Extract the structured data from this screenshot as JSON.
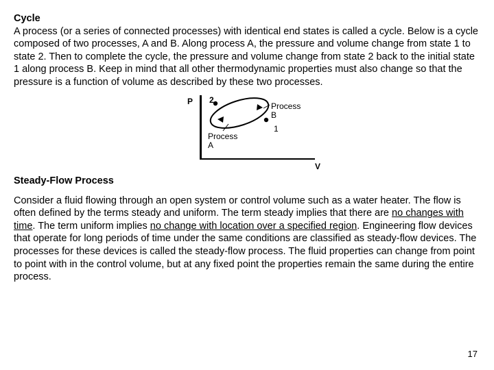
{
  "headings": {
    "cycle": "Cycle",
    "steady": "Steady-Flow Process"
  },
  "para_cycle": "A process (or a series of connected processes) with identical end states is called a cycle.  Below is a cycle composed of two processes, A and B.  Along process A, the pressure and volume change from state 1 to state 2. Then to complete the cycle, the pressure and volume change from state 2 back to the initial state 1 along process B.  Keep in mind that all other thermodynamic properties must also change so that the pressure is a function of volume as described by these two processes.",
  "diagram": {
    "y_axis": "P",
    "x_axis": "V",
    "state1": "1",
    "state2": "2",
    "procA_line1": "Process",
    "procA_line2": "A",
    "procB_line1": "Process",
    "procB_line2": "B"
  },
  "para_steady_pre": "Consider a fluid flowing through an open system or control volume such as a water heater.  The flow is often defined by the terms steady and uniform.  The term steady implies that there are ",
  "para_steady_u1": "no changes with time",
  "para_steady_mid": ".  The term uniform implies ",
  "para_steady_u2": "no change with location over a specified region",
  "para_steady_post": ".   Engineering flow devices that operate for long periods of time under the same conditions are classified as steady-flow devices.  The processes for these devices is called the steady-flow process.  The fluid properties can change from point to point with in the control volume, but at any fixed point the properties remain the same during the entire process.",
  "page_number": "17",
  "chart_data": {
    "type": "line",
    "title": "Thermodynamic cycle on a P–V diagram",
    "xlabel": "V",
    "ylabel": "P",
    "series": [
      {
        "name": "Process A (1→2)",
        "path": "lower arc"
      },
      {
        "name": "Process B (2→1)",
        "path": "upper arc"
      }
    ],
    "states": [
      {
        "name": "1",
        "position": "right (higher V, lower P)"
      },
      {
        "name": "2",
        "position": "left (lower V, higher P)"
      }
    ]
  }
}
